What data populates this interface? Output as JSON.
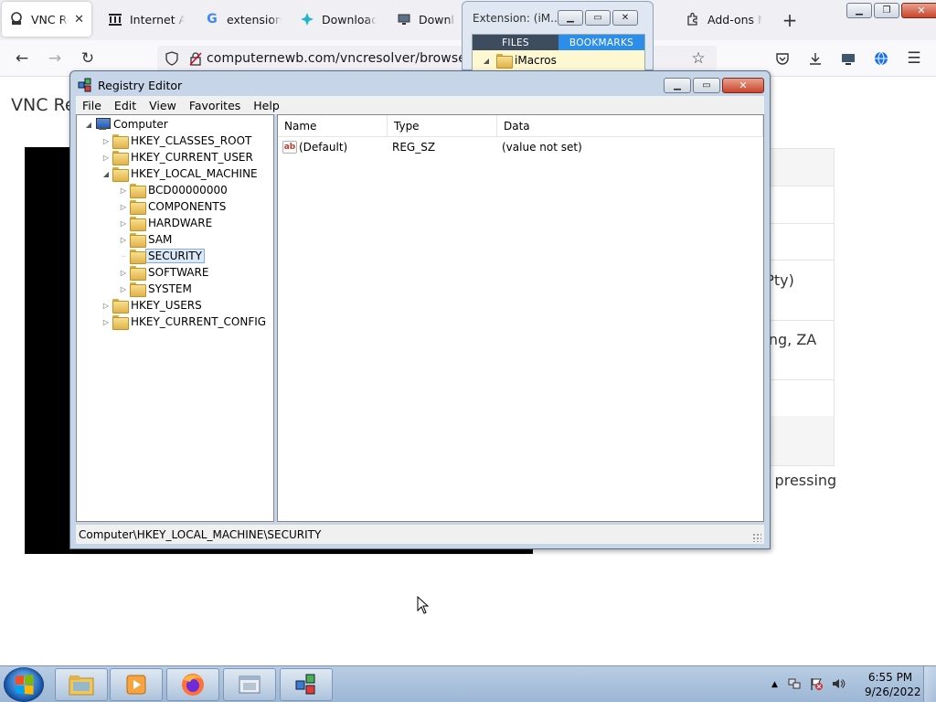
{
  "browser": {
    "tabs": [
      {
        "label": "VNC Resolver",
        "icon": "vnc-icon",
        "active": true
      },
      {
        "label": "Internet Archive",
        "icon": "archive-icon"
      },
      {
        "label": "extensions",
        "icon": "google-icon"
      },
      {
        "label": "Download",
        "icon": "download-site-icon"
      },
      {
        "label": "Download",
        "icon": "monitor-icon"
      },
      {
        "label": "Add-ons Manager",
        "icon": "puzzle-icon"
      }
    ],
    "url": "computernewb.com/vncresolver/browse/"
  },
  "page": {
    "title": "VNC Re",
    "peek_text_1": "(Pty)",
    "peek_text_2": "eng, ZA",
    "peek_text_3": "y pressing"
  },
  "imacros": {
    "title": "Extension: (iM...",
    "tab_files": "FILES",
    "tab_bookmarks": "BOOKMARKS",
    "tree_item": "iMacros"
  },
  "regedit": {
    "title": "Registry Editor",
    "menu": [
      "File",
      "Edit",
      "View",
      "Favorites",
      "Help"
    ],
    "tree": [
      {
        "label": "Computer",
        "level": 0,
        "expander": "open",
        "icon": "computer-icon"
      },
      {
        "label": "HKEY_CLASSES_ROOT",
        "level": 1,
        "expander": "closed"
      },
      {
        "label": "HKEY_CURRENT_USER",
        "level": 1,
        "expander": "closed"
      },
      {
        "label": "HKEY_LOCAL_MACHINE",
        "level": 1,
        "expander": "open"
      },
      {
        "label": "BCD00000000",
        "level": 2,
        "expander": "closed"
      },
      {
        "label": "COMPONENTS",
        "level": 2,
        "expander": "closed"
      },
      {
        "label": "HARDWARE",
        "level": 2,
        "expander": "closed"
      },
      {
        "label": "SAM",
        "level": 2,
        "expander": "closed"
      },
      {
        "label": "SECURITY",
        "level": 2,
        "expander": "none",
        "selected": true
      },
      {
        "label": "SOFTWARE",
        "level": 2,
        "expander": "closed"
      },
      {
        "label": "SYSTEM",
        "level": 2,
        "expander": "closed"
      },
      {
        "label": "HKEY_USERS",
        "level": 1,
        "expander": "closed"
      },
      {
        "label": "HKEY_CURRENT_CONFIG",
        "level": 1,
        "expander": "closed"
      }
    ],
    "columns": [
      "Name",
      "Type",
      "Data"
    ],
    "values": [
      {
        "name": "(Default)",
        "type": "REG_SZ",
        "data": "(value not set)"
      }
    ],
    "status": "Computer\\HKEY_LOCAL_MACHINE\\SECURITY"
  },
  "taskbar": {
    "time": "6:55 PM",
    "date": "9/26/2022"
  },
  "colors": {
    "accent": "#2c8ee8",
    "selection_bg": "#dce9f8"
  }
}
